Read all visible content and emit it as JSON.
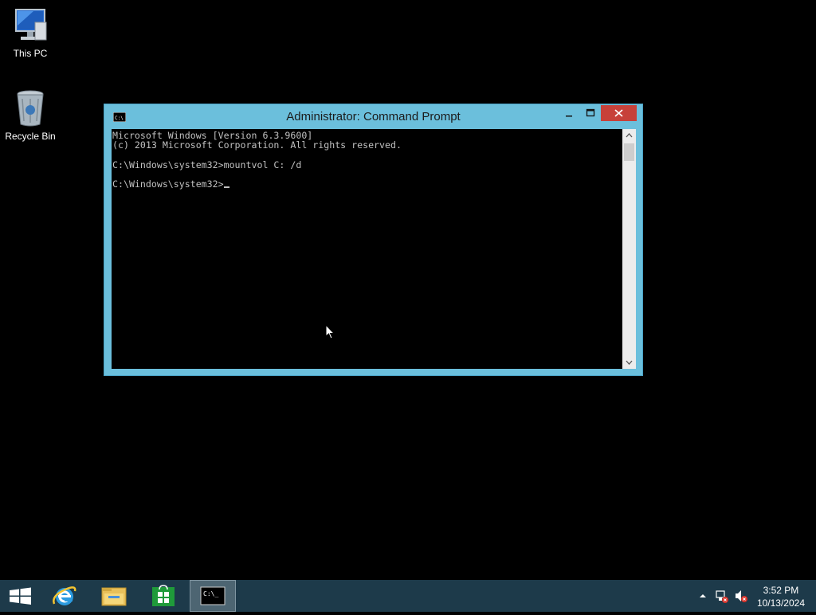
{
  "desktop": {
    "icons": [
      {
        "label": "This PC"
      },
      {
        "label": "Recycle Bin"
      }
    ]
  },
  "window": {
    "title": "Administrator: Command Prompt",
    "app_icon_text": "C:\\.",
    "controls": {
      "minimize": "–",
      "maximize": "□",
      "close": "✕"
    },
    "console_lines": [
      "Microsoft Windows [Version 6.3.9600]",
      "(c) 2013 Microsoft Corporation. All rights reserved.",
      "",
      "C:\\Windows\\system32>mountvol C: /d",
      "",
      "C:\\Windows\\system32>"
    ],
    "scroll": {
      "up": "▲",
      "down": "▼"
    }
  },
  "taskbar": {
    "start": "start-icon",
    "pinned": [
      "internet-explorer-icon",
      "file-explorer-icon",
      "store-icon",
      "command-prompt-icon"
    ],
    "cmd_icon_text": "C:\\_",
    "tray": {
      "overflow": "▴",
      "time": "3:52 PM",
      "date": "10/13/2024"
    }
  }
}
